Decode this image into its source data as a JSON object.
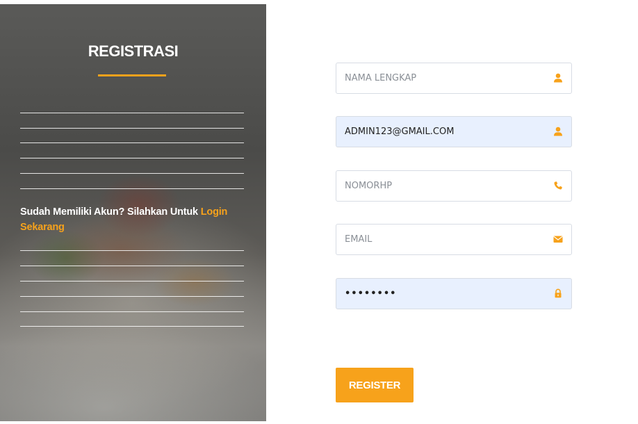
{
  "left_panel": {
    "title": "REGISTRASI",
    "login_prompt": "Sudah Memiliki Akun? Silahkan Untuk ",
    "login_link": "Login Sekarang"
  },
  "form": {
    "fields": [
      {
        "placeholder": "NAMA LENGKAP",
        "value": "",
        "icon": "user-icon"
      },
      {
        "placeholder": "",
        "value": "ADMIN123@GMAIL.COM",
        "icon": "user-icon"
      },
      {
        "placeholder": "NOMORHP",
        "value": "",
        "icon": "phone-icon"
      },
      {
        "placeholder": "EMAIL",
        "value": "",
        "icon": "envelope-icon"
      },
      {
        "placeholder": "",
        "value": "password",
        "icon": "lock-icon"
      }
    ],
    "register_label": "REGISTER"
  },
  "colors": {
    "accent": "#f7a21b",
    "autofill_bg": "#e8f0fe",
    "field_border": "#d7dce4"
  }
}
